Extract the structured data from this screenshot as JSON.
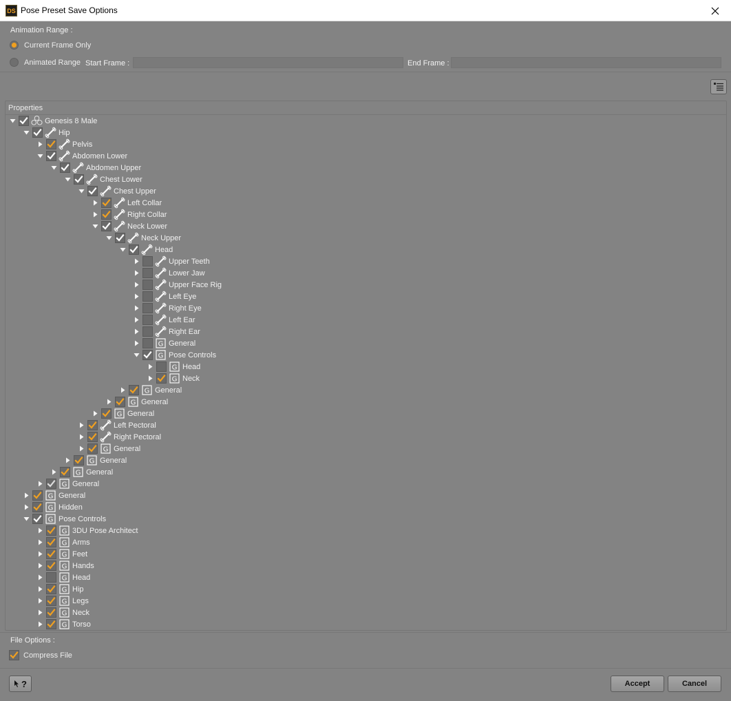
{
  "window": {
    "title": "Pose Preset Save Options",
    "app_icon_text": "DS"
  },
  "animation": {
    "label": "Animation Range :",
    "current_frame_label": "Current Frame Only",
    "animated_range_label": "Animated Range",
    "start_frame_label": "Start Frame :",
    "start_frame_value": "",
    "end_frame_label": "End Frame :",
    "end_frame_value": "",
    "selected": "current"
  },
  "properties": {
    "header": "Properties",
    "rows": [
      {
        "label": "Genesis 8 Male",
        "depth": 0,
        "expanded": true,
        "check": "checked",
        "icon": "figure"
      },
      {
        "label": "Hip",
        "depth": 1,
        "expanded": true,
        "check": "checked",
        "icon": "bone"
      },
      {
        "label": "Pelvis",
        "depth": 2,
        "expanded": false,
        "check": "partial",
        "icon": "bone"
      },
      {
        "label": "Abdomen Lower",
        "depth": 2,
        "expanded": true,
        "check": "checked",
        "icon": "bone"
      },
      {
        "label": "Abdomen Upper",
        "depth": 3,
        "expanded": true,
        "check": "checked",
        "icon": "bone"
      },
      {
        "label": "Chest Lower",
        "depth": 4,
        "expanded": true,
        "check": "checked",
        "icon": "bone"
      },
      {
        "label": "Chest Upper",
        "depth": 5,
        "expanded": true,
        "check": "checked",
        "icon": "bone"
      },
      {
        "label": "Left Collar",
        "depth": 6,
        "expanded": false,
        "check": "partial",
        "icon": "bone"
      },
      {
        "label": "Right Collar",
        "depth": 6,
        "expanded": false,
        "check": "partial",
        "icon": "bone"
      },
      {
        "label": "Neck Lower",
        "depth": 6,
        "expanded": true,
        "check": "checked",
        "icon": "bone"
      },
      {
        "label": "Neck Upper",
        "depth": 7,
        "expanded": true,
        "check": "checked",
        "icon": "bone"
      },
      {
        "label": "Head",
        "depth": 8,
        "expanded": true,
        "check": "checked",
        "icon": "bone"
      },
      {
        "label": "Upper Teeth",
        "depth": 9,
        "expanded": false,
        "check": "unchecked",
        "icon": "bone"
      },
      {
        "label": "Lower Jaw",
        "depth": 9,
        "expanded": false,
        "check": "unchecked",
        "icon": "bone"
      },
      {
        "label": "Upper Face Rig",
        "depth": 9,
        "expanded": false,
        "check": "unchecked",
        "icon": "bone"
      },
      {
        "label": "Left Eye",
        "depth": 9,
        "expanded": false,
        "check": "unchecked",
        "icon": "bone"
      },
      {
        "label": "Right Eye",
        "depth": 9,
        "expanded": false,
        "check": "unchecked",
        "icon": "bone"
      },
      {
        "label": "Left Ear",
        "depth": 9,
        "expanded": false,
        "check": "unchecked",
        "icon": "bone"
      },
      {
        "label": "Right Ear",
        "depth": 9,
        "expanded": false,
        "check": "unchecked",
        "icon": "bone"
      },
      {
        "label": "General",
        "depth": 9,
        "expanded": false,
        "check": "unchecked",
        "icon": "group"
      },
      {
        "label": "Pose Controls",
        "depth": 9,
        "expanded": true,
        "check": "checked",
        "icon": "group"
      },
      {
        "label": "Head",
        "depth": 10,
        "expanded": false,
        "check": "unchecked",
        "icon": "group"
      },
      {
        "label": "Neck",
        "depth": 10,
        "expanded": false,
        "check": "partial",
        "icon": "group"
      },
      {
        "label": "General",
        "depth": 8,
        "expanded": false,
        "check": "partial",
        "icon": "group"
      },
      {
        "label": "General",
        "depth": 7,
        "expanded": false,
        "check": "partial",
        "icon": "group"
      },
      {
        "label": "General",
        "depth": 6,
        "expanded": false,
        "check": "partial",
        "icon": "group"
      },
      {
        "label": "Left Pectoral",
        "depth": 5,
        "expanded": false,
        "check": "partial",
        "icon": "bone"
      },
      {
        "label": "Right Pectoral",
        "depth": 5,
        "expanded": false,
        "check": "partial",
        "icon": "bone"
      },
      {
        "label": "General",
        "depth": 5,
        "expanded": false,
        "check": "partial",
        "icon": "group"
      },
      {
        "label": "General",
        "depth": 4,
        "expanded": false,
        "check": "partial",
        "icon": "group"
      },
      {
        "label": "General",
        "depth": 3,
        "expanded": false,
        "check": "partial",
        "icon": "group"
      },
      {
        "label": "General",
        "depth": 2,
        "expanded": false,
        "check": "checked-dim",
        "icon": "group"
      },
      {
        "label": "General",
        "depth": 1,
        "expanded": false,
        "check": "partial",
        "icon": "group"
      },
      {
        "label": "Hidden",
        "depth": 1,
        "expanded": false,
        "check": "partial",
        "icon": "group"
      },
      {
        "label": "Pose Controls",
        "depth": 1,
        "expanded": true,
        "check": "checked",
        "icon": "group"
      },
      {
        "label": "3DU Pose Architect",
        "depth": 2,
        "expanded": false,
        "check": "partial",
        "icon": "group"
      },
      {
        "label": "Arms",
        "depth": 2,
        "expanded": false,
        "check": "partial",
        "icon": "group"
      },
      {
        "label": "Feet",
        "depth": 2,
        "expanded": false,
        "check": "partial",
        "icon": "group"
      },
      {
        "label": "Hands",
        "depth": 2,
        "expanded": false,
        "check": "partial",
        "icon": "group"
      },
      {
        "label": "Head",
        "depth": 2,
        "expanded": false,
        "check": "unchecked",
        "icon": "group"
      },
      {
        "label": "Hip",
        "depth": 2,
        "expanded": false,
        "check": "partial",
        "icon": "group"
      },
      {
        "label": "Legs",
        "depth": 2,
        "expanded": false,
        "check": "partial",
        "icon": "group"
      },
      {
        "label": "Neck",
        "depth": 2,
        "expanded": false,
        "check": "partial",
        "icon": "group"
      },
      {
        "label": "Torso",
        "depth": 2,
        "expanded": false,
        "check": "partial",
        "icon": "group"
      }
    ]
  },
  "file_options": {
    "label": "File Options :",
    "compress_label": "Compress File",
    "compress_checked": true
  },
  "buttons": {
    "help": "?",
    "accept": "Accept",
    "cancel": "Cancel"
  },
  "colors": {
    "accent": "#f0a020",
    "background": "#838383"
  }
}
